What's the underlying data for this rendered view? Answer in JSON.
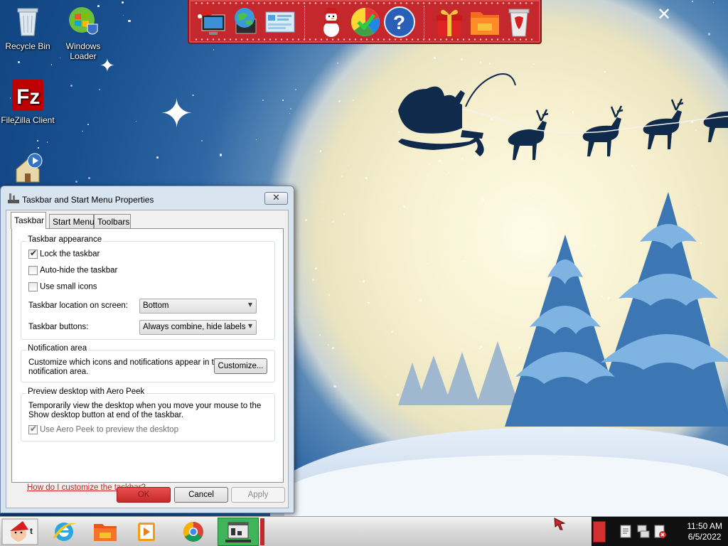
{
  "desktop": {
    "icons": [
      {
        "label": "Recycle Bin",
        "icon": "recycle-bin-icon"
      },
      {
        "label": "Windows Loader",
        "icon": "windows-loader-icon"
      },
      {
        "label": "FileZilla Client",
        "icon": "filezilla-icon"
      },
      {
        "label": "",
        "icon": "home-media-icon"
      }
    ]
  },
  "quick_launch": {
    "items": [
      {
        "icon": "santa-computer-icon"
      },
      {
        "icon": "network-globe-icon"
      },
      {
        "icon": "control-panel-icon"
      },
      {
        "icon": "snowman-icon"
      },
      {
        "icon": "color-wheel-icon"
      },
      {
        "icon": "help-icon",
        "text": "?"
      },
      {
        "icon": "gift-icon"
      },
      {
        "icon": "folder-icon"
      },
      {
        "icon": "trash-icon"
      }
    ]
  },
  "dialog": {
    "title": "Taskbar and Start Menu Properties",
    "close_glyph": "✕",
    "tabs": [
      {
        "label": "Taskbar",
        "active": true
      },
      {
        "label": "Start Menu",
        "active": false
      },
      {
        "label": "Toolbars",
        "active": false
      }
    ],
    "appearance": {
      "title": "Taskbar appearance",
      "lock": {
        "label": "Lock the taskbar",
        "checked": true
      },
      "autohide": {
        "label": "Auto-hide the taskbar",
        "checked": false
      },
      "small_icons": {
        "label": "Use small icons",
        "checked": false
      },
      "location_label": "Taskbar location on screen:",
      "location_value": "Bottom",
      "buttons_label": "Taskbar buttons:",
      "buttons_value": "Always combine, hide labels"
    },
    "notification": {
      "title": "Notification area",
      "desc_line1": "Customize which icons and notifications appear in the",
      "desc_line2": "notification area.",
      "customize_label": "Customize..."
    },
    "aero_peek": {
      "title": "Preview desktop with Aero Peek",
      "desc_line1": "Temporarily view the desktop when you move your mouse to the",
      "desc_line2": "Show desktop button at end of the taskbar.",
      "use_label": "Use Aero Peek to preview the desktop",
      "use_checked": true
    },
    "help_link": "How do I customize the taskbar?",
    "buttons": {
      "ok": "OK",
      "cancel": "Cancel",
      "apply": "Apply"
    },
    "check_glyph": "✔"
  },
  "taskbar": {
    "start_icon": "santa-start-icon",
    "pinned": [
      {
        "icon": "internet-explorer-icon"
      },
      {
        "icon": "file-explorer-icon"
      },
      {
        "icon": "media-player-icon"
      },
      {
        "icon": "chrome-icon"
      },
      {
        "icon": "taskbar-properties-icon",
        "active": true
      }
    ],
    "clock": {
      "time": "11:50 AM",
      "date": "6/5/2022"
    }
  },
  "colors": {
    "accent_red": "#c4282c",
    "ok_button": "#d83a3a",
    "active_task": "#3fb55a",
    "link": "#cc2020"
  }
}
